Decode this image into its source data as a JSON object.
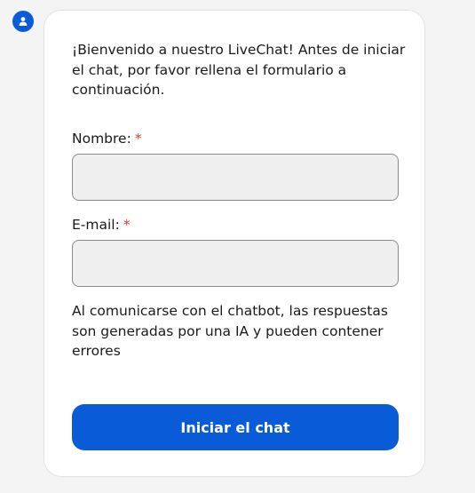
{
  "form": {
    "intro": "¡Bienvenido a nuestro LiveChat! Antes de iniciar el chat, por favor rellena el formulario a continuación.",
    "name_label": "Nombre:",
    "email_label": "E-mail:",
    "required_marker": "*",
    "name_value": "",
    "email_value": "",
    "disclaimer": "Al comunicarse con el chatbot, las respuestas son generadas por una IA y pueden contener errores",
    "submit_label": "Iniciar el chat"
  },
  "colors": {
    "accent": "#0a5bd8",
    "required": "#d9382e",
    "input_bg": "#efefef",
    "page_bg": "#f4f4f4"
  },
  "icons": {
    "avatar": "user-icon"
  }
}
